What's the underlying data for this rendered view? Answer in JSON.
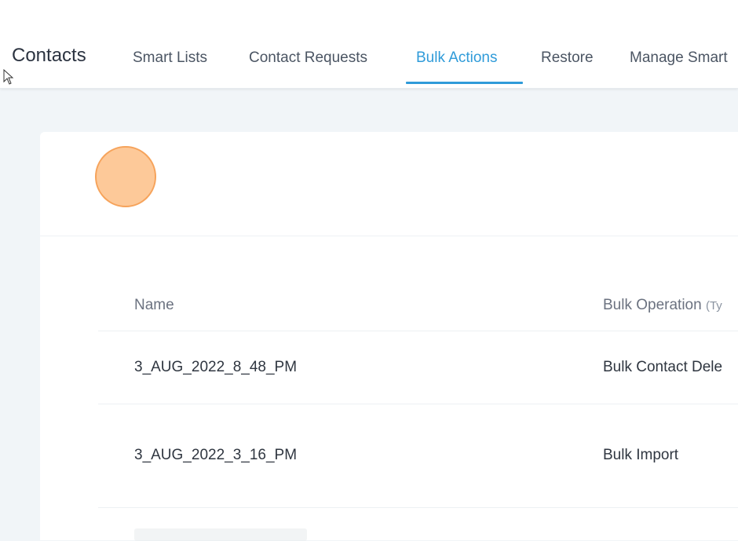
{
  "header": {
    "title": "Contacts",
    "tabs": [
      {
        "label": "Smart Lists",
        "active": false
      },
      {
        "label": "Contact Requests",
        "active": false
      },
      {
        "label": "Bulk Actions",
        "active": true
      },
      {
        "label": "Restore",
        "active": false
      },
      {
        "label": "Manage Smart"
      }
    ]
  },
  "table": {
    "columns": [
      {
        "label": "Name"
      },
      {
        "label": "Bulk Operation",
        "hint": "(Ty"
      }
    ],
    "rows": [
      {
        "name": "3_AUG_2022_8_48_PM",
        "operation": "Bulk Contact Dele"
      },
      {
        "name": "3_AUG_2022_3_16_PM",
        "operation": "Bulk Import"
      }
    ]
  },
  "colors": {
    "accent": "#2f9bd9",
    "background": "#f1f5f8",
    "highlight_fill": "#fdc999",
    "highlight_border": "#f6a35b"
  }
}
